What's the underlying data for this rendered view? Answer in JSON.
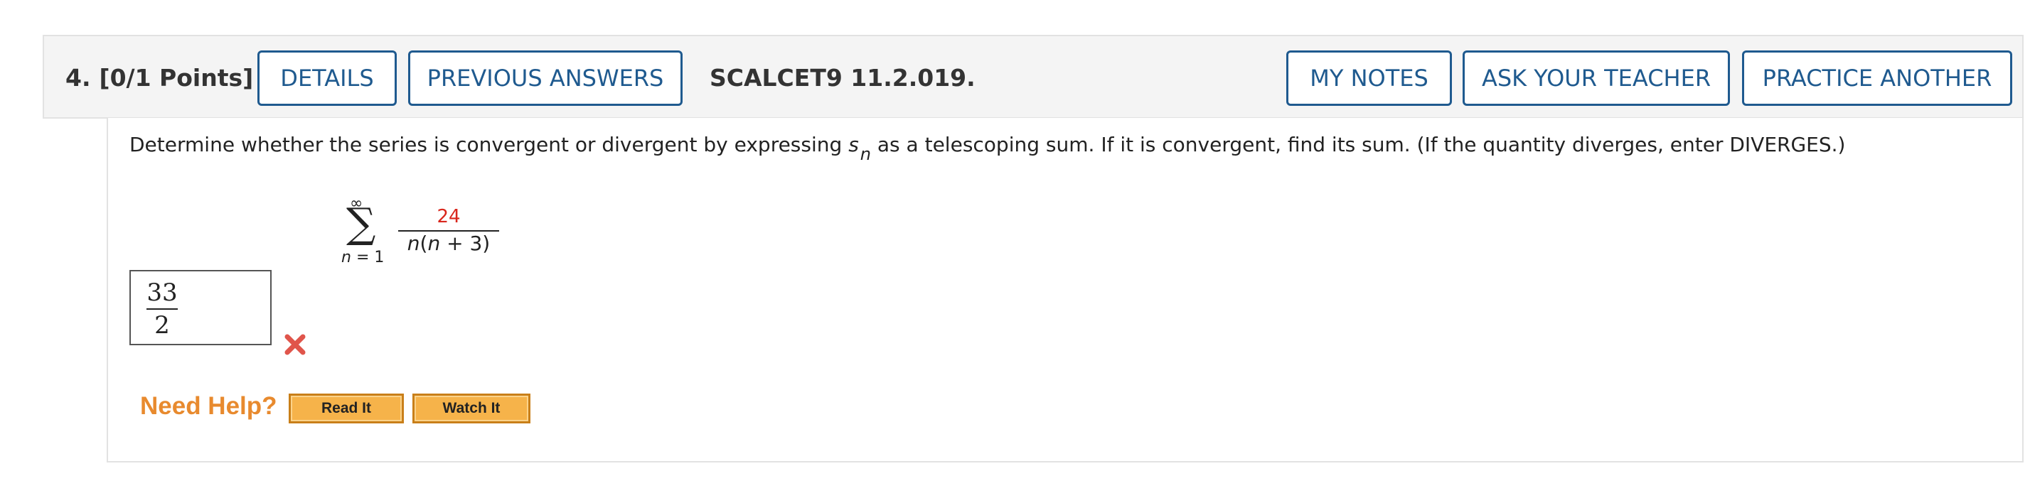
{
  "question": {
    "number": "4.",
    "points": "[0/1 Points]",
    "code": "SCALCET9 11.2.019."
  },
  "buttons": {
    "details": "DETAILS",
    "previous_answers": "PREVIOUS ANSWERS",
    "my_notes": "MY NOTES",
    "ask_your_teacher": "ASK YOUR TEACHER",
    "practice_another": "PRACTICE ANOTHER"
  },
  "prompt": {
    "before": "Determine whether the series is convergent or divergent by expressing ",
    "var": "s",
    "sub": "n",
    "after": " as a telescoping sum. If it is convergent, find its sum. (If the quantity diverges, enter DIVERGES.)"
  },
  "series": {
    "upper": "∞",
    "sigma": "∑",
    "lower_var": "n",
    "lower_eq": " = 1",
    "numerator": "24",
    "denominator_a": "n",
    "denominator_b": "(",
    "denominator_c": "n",
    "denominator_d": " + 3)"
  },
  "answer": {
    "numerator": "33",
    "denominator": "2",
    "status_icon": "wrong-icon",
    "status_color": "#e0554b"
  },
  "help": {
    "label": "Need Help?",
    "read_it": "Read It",
    "watch_it": "Watch It"
  },
  "colors": {
    "accent": "#1f5a8f",
    "help": "#e88a2e",
    "help_button": "#f6b34a",
    "numerator": "#d9261c"
  }
}
